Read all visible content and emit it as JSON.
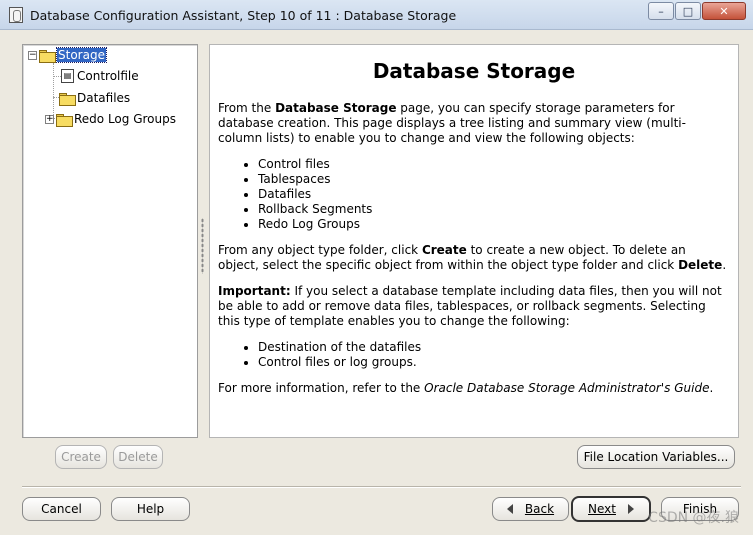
{
  "window": {
    "title": "Database Configuration Assistant, Step 10 of 11 : Database Storage",
    "minimize": "–",
    "maximize": "□",
    "close": "✕"
  },
  "tree": {
    "root": "Storage",
    "items": [
      "Controlfile",
      "Datafiles",
      "Redo Log Groups"
    ],
    "expanders": {
      "root": "−",
      "redo": "+"
    },
    "controlfile_icon_text": "▤"
  },
  "content": {
    "title": "Database Storage",
    "p1": {
      "pre": "From the ",
      "bold": "Database Storage",
      "post": " page, you can specify storage parameters for database creation. This page displays a tree listing and summary view (multi-column lists) to enable you to change and view the following objects:"
    },
    "list1": [
      "Control files",
      "Tablespaces",
      "Datafiles",
      "Rollback Segments",
      "Redo Log Groups"
    ],
    "p2": {
      "pre": "From any object type folder, click ",
      "bold1": "Create",
      "mid": " to create a new object. To delete an object, select the specific object from within the object type folder and click ",
      "bold2": "Delete",
      "post": "."
    },
    "p3": {
      "bold": "Important:",
      "post": " If you select a database template including data files, then you will not be able to add or remove data files, tablespaces, or rollback segments. Selecting this type of template enables you to change the following:"
    },
    "list2": [
      "Destination of the datafiles",
      "Control files or log groups."
    ],
    "p4": {
      "pre": "For more information, refer to the ",
      "italic": "Oracle Database Storage Administrator's Guide",
      "post": "."
    }
  },
  "buttons": {
    "create": "Create",
    "delete": "Delete",
    "file_location": "File Location Variables...",
    "cancel": "Cancel",
    "help": "Help",
    "back": "Back",
    "next": "Next",
    "finish": "Finish"
  },
  "watermark": "CSDN @夜.狼"
}
